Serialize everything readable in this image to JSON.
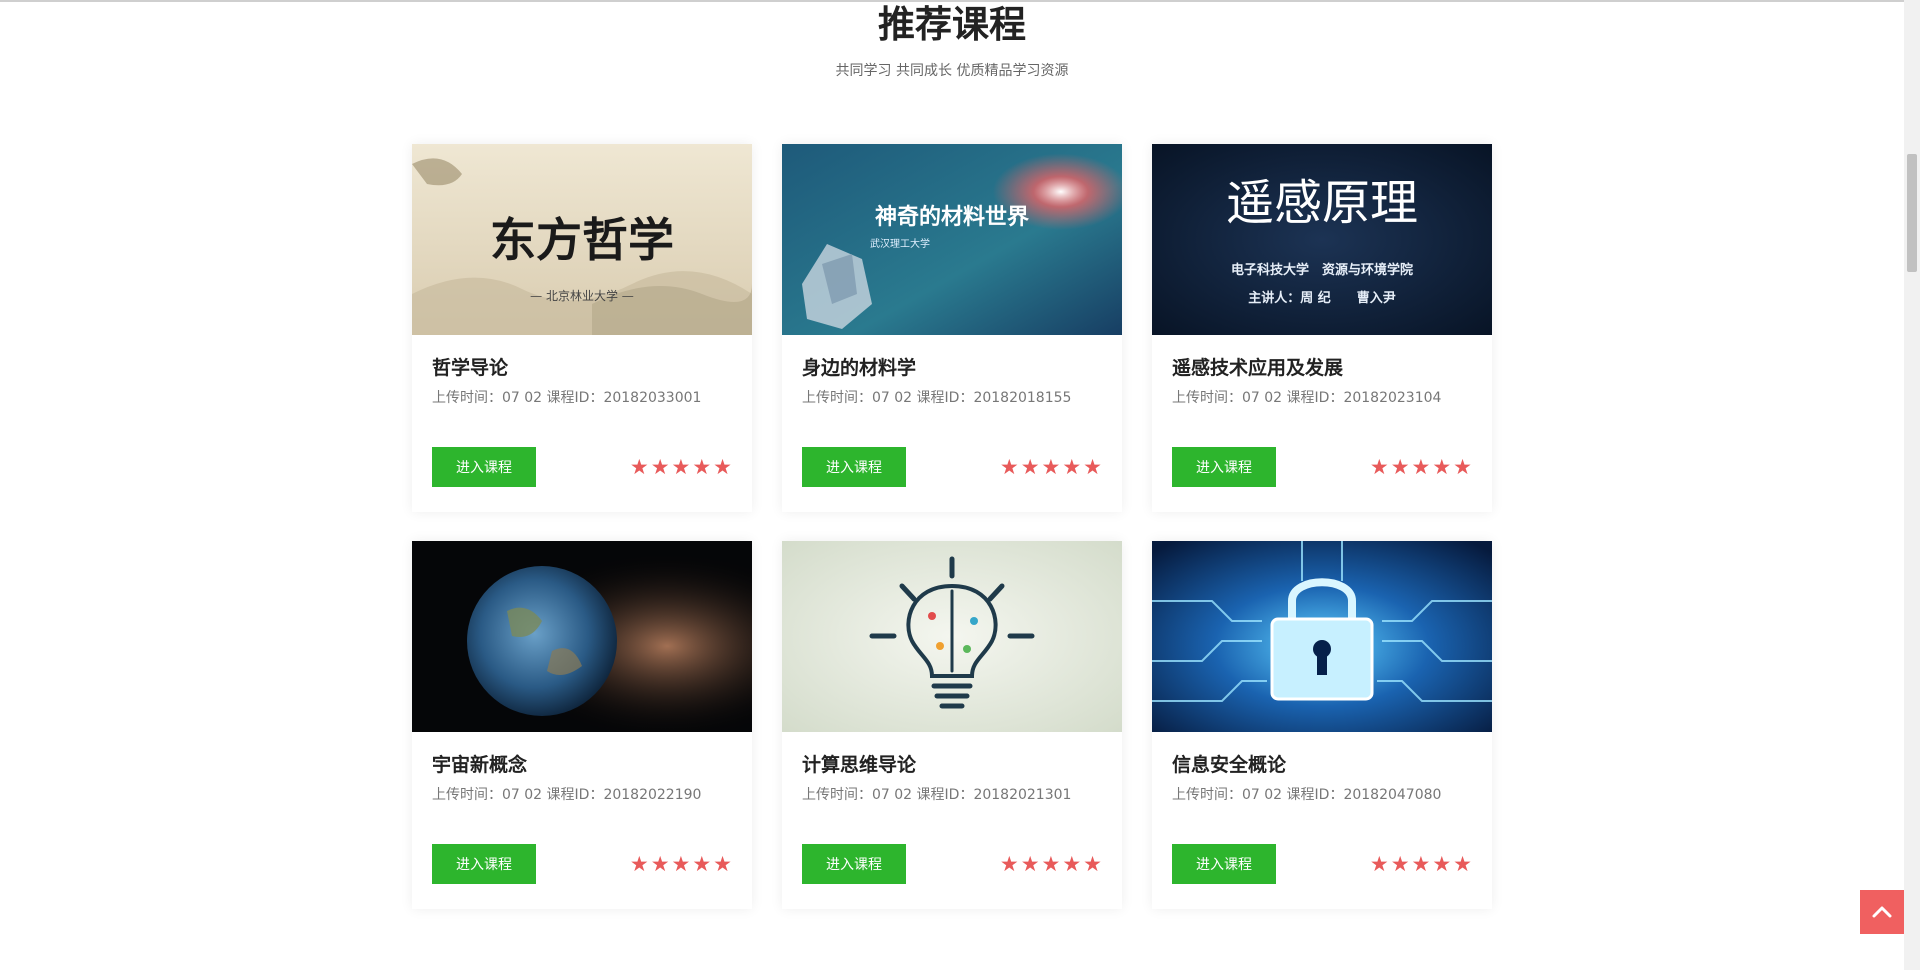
{
  "section": {
    "title": "推荐课程",
    "subtitle": "共同学习 共同成长 优质精品学习资源"
  },
  "button_label": "进入课程",
  "meta_prefix": "上传时间：07 02 课程ID：",
  "courses": [
    {
      "title": "哲学导论",
      "meta": "上传时间：07 02 课程ID：20182033001",
      "rating": 5,
      "image": {
        "text": "东方哲学",
        "subtext": "— 北京林业大学 —"
      }
    },
    {
      "title": "身边的材料学",
      "meta": "上传时间：07 02 课程ID：20182018155",
      "rating": 5,
      "image": {
        "text": "神奇的材料世界",
        "subtext": "武汉理工大学"
      }
    },
    {
      "title": "遥感技术应用及发展",
      "meta": "上传时间：07 02 课程ID：20182023104",
      "rating": 5,
      "image": {
        "text": "遥感原理",
        "subtext": "电子科技大学　资源与环境学院",
        "subtext2": "主讲人：周 纪　　曹入尹"
      }
    },
    {
      "title": "宇宙新概念",
      "meta": "上传时间：07 02 课程ID：20182022190",
      "rating": 5,
      "image": {
        "icon": "earth-icon"
      }
    },
    {
      "title": "计算思维导论",
      "meta": "上传时间：07 02 课程ID：20182021301",
      "rating": 5,
      "image": {
        "icon": "lightbulb-brain-icon"
      }
    },
    {
      "title": "信息安全概论",
      "meta": "上传时间：07 02 课程ID：20182047080",
      "rating": 5,
      "image": {
        "icon": "lock-circuit-icon"
      }
    }
  ],
  "colors": {
    "button": "#2db52d",
    "star": "#e85a5a",
    "back_to_top": "#f06060"
  },
  "icons": {
    "star": "star-icon",
    "back_to_top": "chevron-up-icon"
  }
}
